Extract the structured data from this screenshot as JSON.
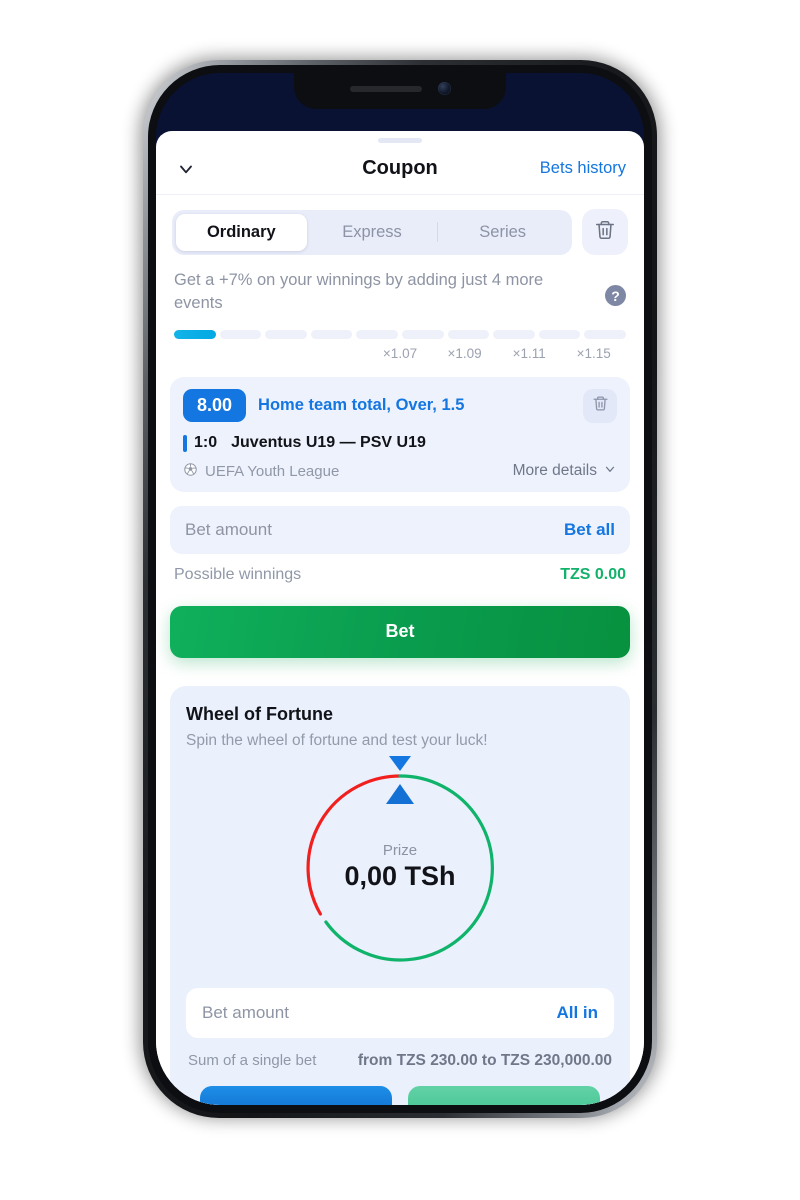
{
  "header": {
    "title": "Coupon",
    "back_icon": "chevron-down-icon",
    "history_link": "Bets history"
  },
  "tabs": {
    "items": [
      {
        "label": "Ordinary",
        "active": true
      },
      {
        "label": "Express",
        "active": false
      },
      {
        "label": "Series",
        "active": false
      }
    ],
    "clear_icon": "trash-icon"
  },
  "promo": {
    "text": "Get a +7% on your winnings by adding just 4 more events",
    "help_icon": "question-mark-icon",
    "help_glyph": "?",
    "segments_total": 10,
    "segments_filled": 1,
    "multipliers": [
      "×1.07",
      "×1.09",
      "×1.11",
      "×1.15"
    ],
    "fill_color": "#03a9e3"
  },
  "bet_card": {
    "odds": "8.00",
    "market": "Home team total, Over, 1.5",
    "delete_icon": "trash-icon",
    "score": "1:0",
    "teams": "Juventus U19 — PSV U19",
    "league": "UEFA Youth League",
    "league_icon": "soccer-ball-icon",
    "more_details": "More details",
    "more_icon": "chevron-down-icon",
    "accent_color": "#1476e0"
  },
  "bet_amount": {
    "placeholder": "Bet amount",
    "action": "Bet all",
    "winnings_label": "Possible winnings",
    "winnings_value": "TZS 0.00",
    "winnings_color": "#12b26a"
  },
  "submit": {
    "label": "Bet",
    "color": "#0a9c4e"
  },
  "wheel": {
    "title": "Wheel of Fortune",
    "subtitle": "Spin the wheel of fortune and test your luck!",
    "prize_label": "Prize",
    "prize_value": "0,00 TSh",
    "pointer_icon": "triangle-pointer-icon",
    "arc_red_color": "#f1201f",
    "arc_green_color": "#0fb36a",
    "arc_red_share_deg": 150,
    "arc_green_share_deg": 205,
    "amount_placeholder": "Bet amount",
    "amount_action": "All in",
    "limit_label": "Sum of a single bet",
    "limit_value": "from TZS 230.00 to TZS 230,000.00"
  },
  "bottom_buttons": [
    {
      "name": "blue-action-button",
      "color": "#0a63c4"
    },
    {
      "name": "green-action-button",
      "color": "#3cc08c"
    }
  ]
}
